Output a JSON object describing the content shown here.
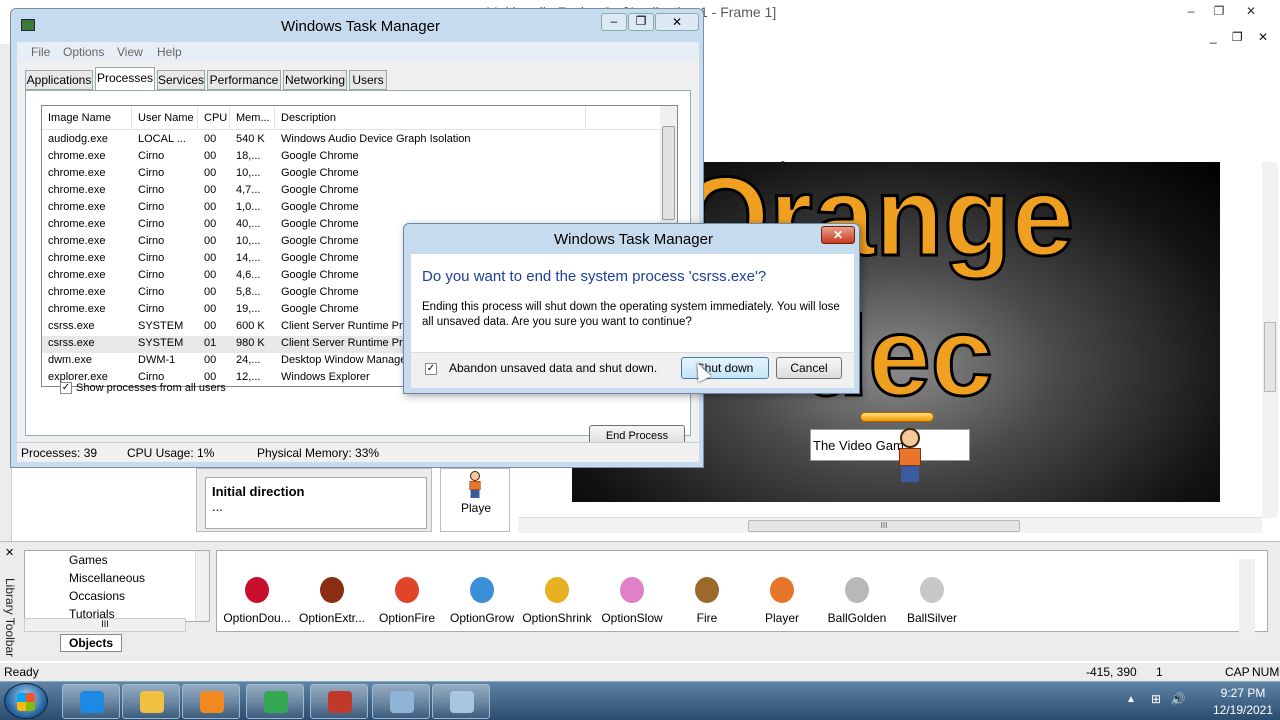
{
  "mmf": {
    "title": "Multimedia Fusion 2 - [Application 1 - Frame 1]",
    "window_controls": [
      "–",
      "❐",
      "✕"
    ],
    "mdi_controls": "_ ❐ ✕",
    "zero_marker": "0",
    "canvas_text_line1": "Orange",
    "canvas_text_line2": "dec",
    "video_label": "The Video Gam",
    "scroll_grip": "III",
    "properties": {
      "title": "Initial direction",
      "value": "..."
    },
    "player_thumb_label": "Playe",
    "library": {
      "vertical_label": "Library Toolbar",
      "close_glyph": "✕",
      "tree_items": [
        "Games",
        "Miscellaneous",
        "Occasions",
        "Tutorials"
      ],
      "tab_objects": "Objects",
      "objects": [
        {
          "label": "OptionDou...",
          "color": "#c8102e"
        },
        {
          "label": "OptionExtr...",
          "color": "#8b2d10"
        },
        {
          "label": "OptionFire",
          "color": "#e0452a"
        },
        {
          "label": "OptionGrow",
          "color": "#3a8fd8"
        },
        {
          "label": "OptionShrink",
          "color": "#e6b020"
        },
        {
          "label": "OptionSlow",
          "color": "#e080c8"
        },
        {
          "label": "Fire",
          "color": "#9b6a2a"
        },
        {
          "label": "Player",
          "color": "#e8762a"
        },
        {
          "label": "BallGolden",
          "color": "#b8b8b8"
        },
        {
          "label": "BallSilver",
          "color": "#c8c8c8"
        }
      ]
    },
    "status": {
      "ready": "Ready",
      "coords": "-415, 390",
      "num1": "1",
      "cap": "CAP",
      "num": "NUM"
    }
  },
  "taskmgr": {
    "title": "Windows Task Manager",
    "menu": [
      "File",
      "Options",
      "View",
      "Help"
    ],
    "tabs": [
      "Applications",
      "Processes",
      "Services",
      "Performance",
      "Networking",
      "Users"
    ],
    "active_tab": "Processes",
    "columns": [
      "Image Name",
      "User Name",
      "CPU",
      "Mem...",
      "Description"
    ],
    "rows": [
      [
        "audiodg.exe",
        "LOCAL ...",
        "00",
        "540 K",
        "Windows Audio Device Graph Isolation"
      ],
      [
        "chrome.exe",
        "Cirno",
        "00",
        "18,...",
        "Google Chrome"
      ],
      [
        "chrome.exe",
        "Cirno",
        "00",
        "10,...",
        "Google Chrome"
      ],
      [
        "chrome.exe",
        "Cirno",
        "00",
        "4,7...",
        "Google Chrome"
      ],
      [
        "chrome.exe",
        "Cirno",
        "00",
        "1,0...",
        "Google Chrome"
      ],
      [
        "chrome.exe",
        "Cirno",
        "00",
        "40,...",
        "Google Chrome"
      ],
      [
        "chrome.exe",
        "Cirno",
        "00",
        "10,...",
        "Google Chrome"
      ],
      [
        "chrome.exe",
        "Cirno",
        "00",
        "14,...",
        "Google Chrome"
      ],
      [
        "chrome.exe",
        "Cirno",
        "00",
        "4,6...",
        "Google Chrome"
      ],
      [
        "chrome.exe",
        "Cirno",
        "00",
        "5,8...",
        "Google Chrome"
      ],
      [
        "chrome.exe",
        "Cirno",
        "00",
        "19,...",
        "Google Chrome"
      ],
      [
        "csrss.exe",
        "SYSTEM",
        "00",
        "600 K",
        "Client Server Runtime Pro"
      ],
      [
        "csrss.exe",
        "SYSTEM",
        "01",
        "980 K",
        "Client Server Runtime Pro"
      ],
      [
        "dwm.exe",
        "DWM-1",
        "00",
        "24,...",
        "Desktop Window Manage"
      ],
      [
        "explorer.exe",
        "Cirno",
        "00",
        "12,...",
        "Windows Explorer"
      ]
    ],
    "selected_row_index": 12,
    "show_all_label": "Show processes from all users",
    "show_all_checked": "✓",
    "end_process_label": "End Process",
    "status": {
      "processes": "Processes: 39",
      "cpu": "CPU Usage: 1%",
      "memory": "Physical Memory: 33%"
    }
  },
  "dialog": {
    "title": "Windows Task Manager",
    "close_glyph": "✕",
    "question": "Do you want to end the system process 'csrss.exe'?",
    "body": "Ending this process will shut down the operating system immediately.  You will lose all unsaved data.  Are you sure you want to continue?",
    "abandon_label": "Abandon unsaved data and shut down.",
    "abandon_checked": "✓",
    "shutdown_label": "Shut down",
    "cancel_label": "Cancel"
  },
  "taskbar": {
    "apps": [
      {
        "name": "Internet Explorer",
        "color": "#1e88e5"
      },
      {
        "name": "Windows Explorer",
        "color": "#f0c040"
      },
      {
        "name": "Media Player",
        "color": "#f08a20"
      },
      {
        "name": "Google Chrome",
        "color": "#34a853"
      },
      {
        "name": "Multimedia Fusion 2",
        "color": "#c0392b"
      },
      {
        "name": "Control Panel",
        "color": "#8fb4d6"
      },
      {
        "name": "Task Manager",
        "color": "#a9c6e0"
      }
    ],
    "tray_icons": [
      "⊞",
      "🔊"
    ],
    "time": "9:27 PM",
    "date": "12/19/2021"
  }
}
